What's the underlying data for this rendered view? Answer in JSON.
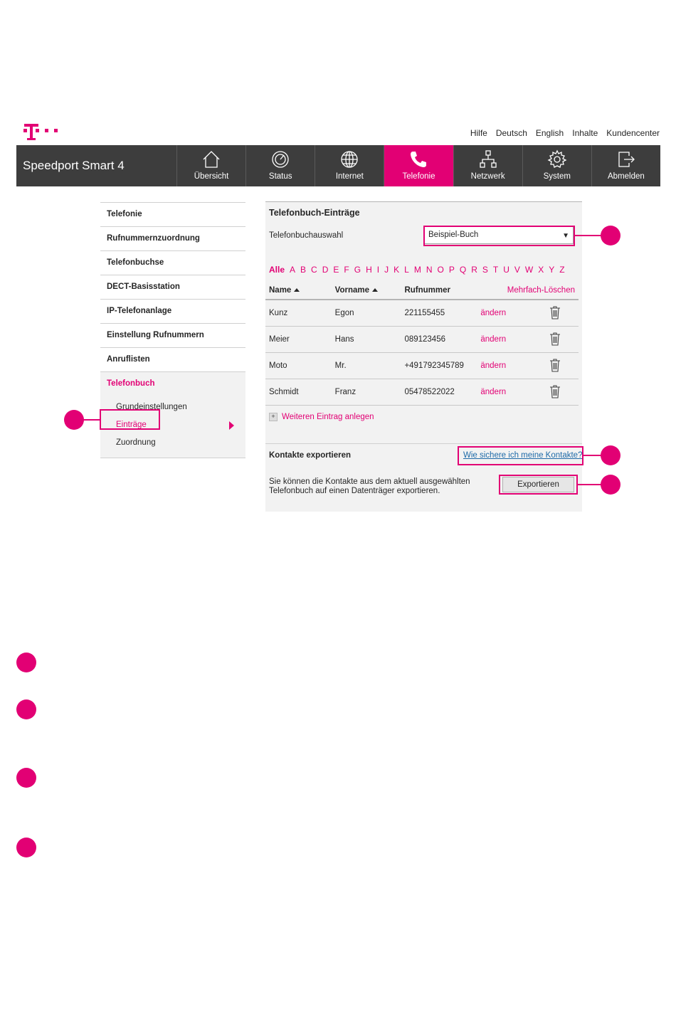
{
  "header": {
    "links": [
      "Hilfe",
      "Deutsch",
      "English",
      "Inhalte",
      "Kundencenter"
    ]
  },
  "nav": {
    "brand": "Speedport Smart 4",
    "items": [
      {
        "label": "Übersicht",
        "icon": "home-icon"
      },
      {
        "label": "Status",
        "icon": "gauge-icon"
      },
      {
        "label": "Internet",
        "icon": "globe-icon"
      },
      {
        "label": "Telefonie",
        "icon": "phone-icon",
        "active": true
      },
      {
        "label": "Netzwerk",
        "icon": "network-icon"
      },
      {
        "label": "System",
        "icon": "gear-icon"
      },
      {
        "label": "Abmelden",
        "icon": "logout-icon"
      }
    ]
  },
  "sidebar": {
    "items": [
      "Telefonie",
      "Rufnummernzuordnung",
      "Telefonbuchse",
      "DECT-Basisstation",
      "IP-Telefonanlage",
      "Einstellung Rufnummern",
      "Anruflisten",
      "Telefonbuch"
    ],
    "subitems": [
      "Grundeinstellungen",
      "Einträge",
      "Zuordnung"
    ]
  },
  "main": {
    "title": "Telefonbuch-Einträge",
    "select_label": "Telefonbuchauswahl",
    "select_value": "Beispiel-Buch",
    "alphabet": [
      "Alle",
      "A",
      "B",
      "C",
      "D",
      "E",
      "F",
      "G",
      "H",
      "I",
      "J",
      "K",
      "L",
      "M",
      "N",
      "O",
      "P",
      "Q",
      "R",
      "S",
      "T",
      "U",
      "V",
      "W",
      "X",
      "Y",
      "Z"
    ],
    "columns": {
      "name": "Name",
      "vorname": "Vorname",
      "rufnummer": "Rufnummer",
      "multi_delete": "Mehrfach-Löschen"
    },
    "rows": [
      {
        "name": "Kunz",
        "vorname": "Egon",
        "nummer": "221155455",
        "edit": "ändern"
      },
      {
        "name": "Meier",
        "vorname": "Hans",
        "nummer": "089123456",
        "edit": "ändern"
      },
      {
        "name": "Moto",
        "vorname": "Mr.",
        "nummer": "+491792345789",
        "edit": "ändern"
      },
      {
        "name": "Schmidt",
        "vorname": "Franz",
        "nummer": "05478522022",
        "edit": "ändern"
      }
    ],
    "add_entry": "Weiteren Eintrag anlegen",
    "export": {
      "title": "Kontakte exportieren",
      "help_link": "Wie sichere ich meine Kontakte?",
      "text": "Sie können die Kontakte aus dem aktuell ausgewählten Telefonbuch auf einen Datenträger exportieren.",
      "button": "Exportieren"
    }
  },
  "colors": {
    "accent": "#e20074",
    "nav_bg": "#3d3d3d",
    "panel_bg": "#f2f2f2"
  }
}
